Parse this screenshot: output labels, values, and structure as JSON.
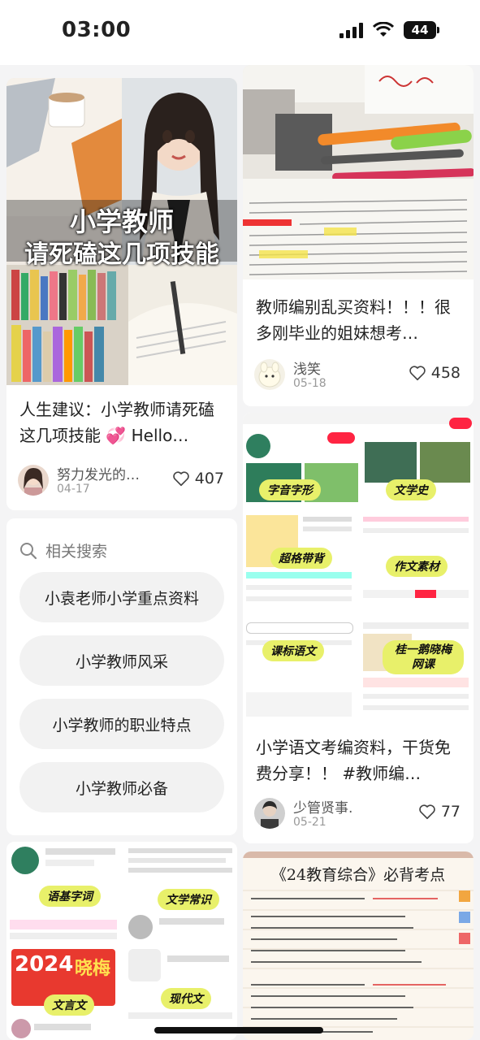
{
  "status_bar": {
    "time": "03:00",
    "battery": "44"
  },
  "feed": {
    "card1": {
      "cover_line1": "小学教师",
      "cover_line2": "请死磕这几项技能",
      "title": "人生建议：小学教师请死磕这几项技能 💞 Hello…",
      "author": "努力发光的…",
      "date": "04-17",
      "likes": "407"
    },
    "card2": {
      "title": "教师编别乱买资料！！！很多刚毕业的姐妹想考…",
      "author": "浅笑",
      "date": "05-18",
      "likes": "458"
    },
    "card3": {
      "title": "小学语文考编资料，干货免费分享！！ #教师编…",
      "author": "少管贤事.",
      "date": "05-21",
      "likes": "77",
      "tags": [
        "字音字形",
        "文学史",
        "超格带背",
        "作文素材",
        "课标语文",
        "桂一鹅晓梅网课"
      ]
    },
    "card4": {
      "tags": [
        "语基字词",
        "文学常识",
        "文言文",
        "现代文"
      ],
      "year": "2024",
      "name": "晓梅"
    },
    "card5": {
      "cover_title": "《24教育综合》必背考点"
    }
  },
  "related": {
    "header": "相关搜索",
    "items": [
      "小袁老师小学重点资料",
      "小学教师风采",
      "小学教师的职业特点",
      "小学教师必备"
    ]
  },
  "colors": {
    "accent": "#ff2442",
    "tag": "#e8f06a"
  }
}
